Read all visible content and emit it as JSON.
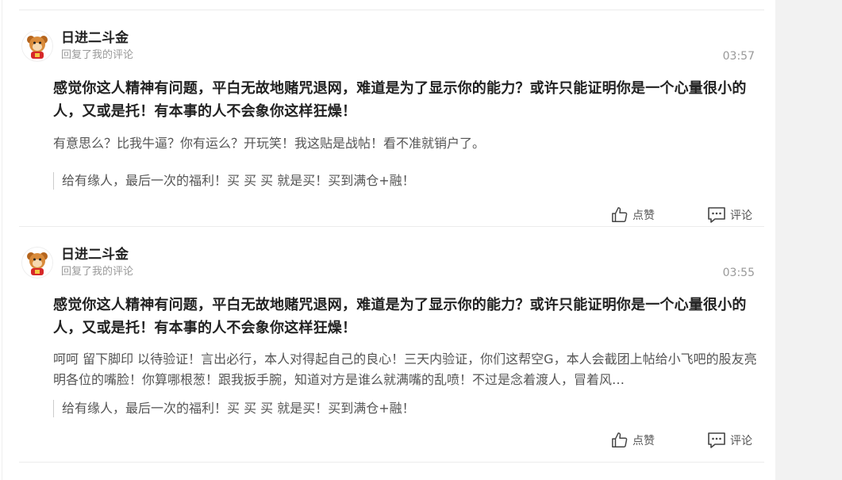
{
  "items": [
    {
      "username": "日进二斗金",
      "action": "回复了我的评论",
      "time": "03:57",
      "main_text": "感觉你这人精神有问题，平白无故地赌咒退网，难道是为了显示你的能力？或许只能证明你是一个心量很小的人，又或是托！有本事的人不会象你这样狂燥！",
      "reply_text": "有意思么？比我牛逼？你有运么？开玩笑！我这贴是战帖！看不准就销户了。",
      "quote_text": "给有缘人，最后一次的福利！买 买 买 就是买！买到满仓+融！",
      "like_label": "点赞",
      "comment_label": "评论"
    },
    {
      "username": "日进二斗金",
      "action": "回复了我的评论",
      "time": "03:55",
      "main_text": "感觉你这人精神有问题，平白无故地赌咒退网，难道是为了显示你的能力？或许只能证明你是一个心量很小的人，又或是托！有本事的人不会象你这样狂燥！",
      "reply_text": "呵呵 留下脚印 以待验证！言出必行，本人对得起自己的良心！三天内验证，你们这帮空G，本人会截团上帖给小飞吧的股友亮明各位的嘴脸！你算哪根葱！跟我扳手腕，知道对方是谁么就满嘴的乱喷！不过是念着渡人，冒着风…",
      "quote_text": "给有缘人，最后一次的福利！买 买 买 就是买！买到满仓+融！",
      "like_label": "点赞",
      "comment_label": "评论"
    }
  ],
  "icons": {
    "like": "thumbs-up-icon",
    "comment": "comment-bubble-icon",
    "avatar": "cartoon-mascot-avatar"
  },
  "colors": {
    "username": "#222222",
    "meta": "#999999",
    "body": "#555555",
    "divider": "#ececec",
    "side_panel": "#f2f2f2"
  }
}
